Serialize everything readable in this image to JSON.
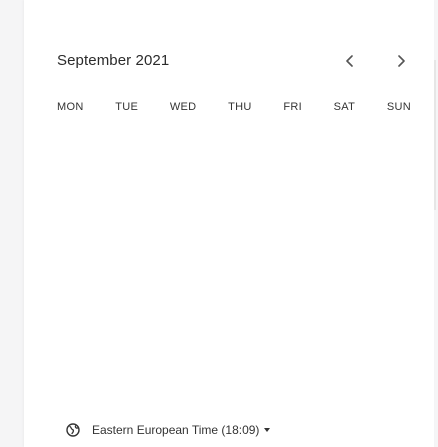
{
  "calendar": {
    "month_title": "September 2021",
    "weekdays": [
      "MON",
      "TUE",
      "WED",
      "THU",
      "FRI",
      "SAT",
      "SUN"
    ],
    "nav": {
      "prev_icon": "chevron-left-icon",
      "next_icon": "chevron-right-icon"
    }
  },
  "timezone": {
    "icon": "globe-icon",
    "label": "Eastern European Time (18:09)",
    "dropdown_icon": "caret-down-icon"
  },
  "colors": {
    "background": "#f5f5f6",
    "panel": "#ffffff",
    "text": "#2b2b2b"
  }
}
